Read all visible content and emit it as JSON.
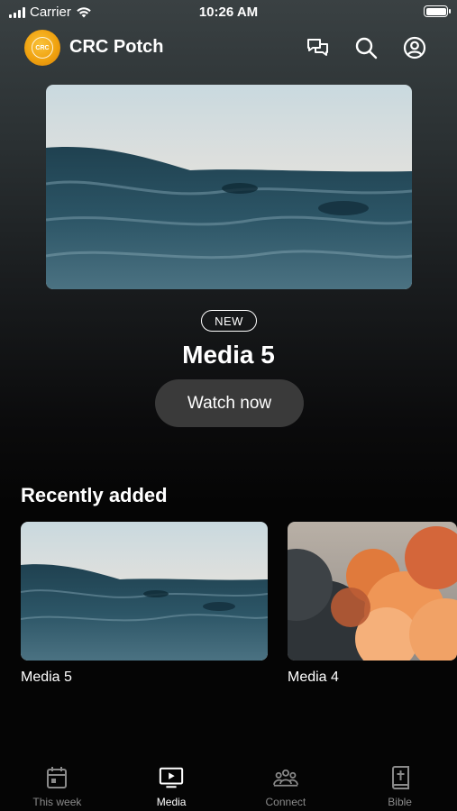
{
  "status_bar": {
    "carrier": "Carrier",
    "time": "10:26 AM"
  },
  "header": {
    "logo_text": "CRC",
    "app_title": "CRC Potch",
    "icons": [
      "chat-icon",
      "search-icon",
      "profile-icon"
    ]
  },
  "hero": {
    "badge": "NEW",
    "title": "Media 5",
    "watch_label": "Watch now"
  },
  "recently_added": {
    "title": "Recently added",
    "items": [
      {
        "label": "Media 5",
        "thumbnail": "ocean-waves"
      },
      {
        "label": "Media 4",
        "thumbnail": "sunset-clouds"
      }
    ]
  },
  "tabbar": {
    "items": [
      {
        "label": "This week",
        "icon": "calendar-icon",
        "active": false
      },
      {
        "label": "Media",
        "icon": "play-screen-icon",
        "active": true
      },
      {
        "label": "Connect",
        "icon": "people-icon",
        "active": false
      },
      {
        "label": "Bible",
        "icon": "bible-icon",
        "active": false
      }
    ]
  },
  "colors": {
    "accent_logo": "#f0a20f",
    "button_bg": "#3a3a3a",
    "inactive_tab": "#8a8a8a",
    "background_dark": "#050505"
  }
}
